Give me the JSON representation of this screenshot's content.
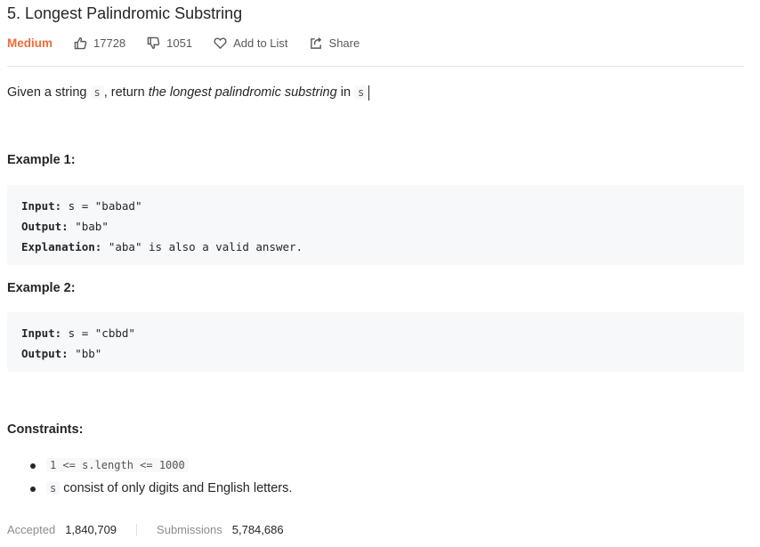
{
  "problem": {
    "title": "5. Longest Palindromic Substring",
    "difficulty": "Medium",
    "likes": "17728",
    "dislikes": "1051",
    "add_to_list": "Add to List",
    "share": "Share"
  },
  "description": {
    "p1": "Given a string ",
    "code1": "s",
    "p2": ", return ",
    "em": "the longest palindromic substring",
    "p3": " in ",
    "code2": "s",
    "p4": "."
  },
  "examples": [
    {
      "heading": "Example 1:",
      "input_label": "Input:",
      "input_value": " s = \"babad\"",
      "output_label": "Output:",
      "output_value": " \"bab\"",
      "explanation_label": "Explanation:",
      "explanation_value": " \"aba\" is also a valid answer."
    },
    {
      "heading": "Example 2:",
      "input_label": "Input:",
      "input_value": " s = \"cbbd\"",
      "output_label": "Output:",
      "output_value": " \"bb\""
    }
  ],
  "constraints": {
    "heading": "Constraints:",
    "c1_code": "1 <= s.length <= 1000",
    "c2_code": "s",
    "c2_text": " consist of only digits and English letters."
  },
  "stats": {
    "accepted_label": "Accepted",
    "accepted_value": "1,840,709",
    "submissions_label": "Submissions",
    "submissions_value": "5,784,686"
  }
}
